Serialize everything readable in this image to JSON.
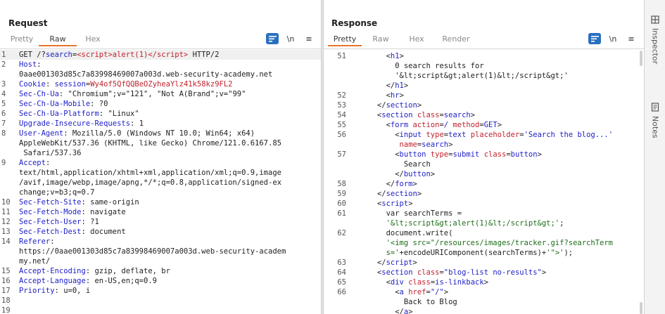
{
  "request": {
    "title": "Request",
    "tabs": [
      {
        "label": "Pretty"
      },
      {
        "label": "Raw"
      },
      {
        "label": "Hex"
      }
    ],
    "toolbar": {
      "newline_label": "\\n",
      "menu_label": "≡"
    },
    "lines": [
      {
        "n": "1",
        "code": "GET /?<span class=\"k\">search</span>=<span class=\"rd\">&lt;script&gt;alert(1)&lt;/script&gt;</span> HTTP/2"
      },
      {
        "n": "2",
        "code": "<span class=\"k\">Host</span>:"
      },
      {
        "n": "",
        "code": "0aae001303d85c7a83998469007a003d.web-security-academy.net"
      },
      {
        "n": "3",
        "code": "<span class=\"k\">Cookie</span>: <span class=\"k\">session</span>=<span class=\"rd\">Wy4of5QfQQBeOZyheaYlz41k58kz9FL2</span>"
      },
      {
        "n": "4",
        "code": "<span class=\"k\">Sec-Ch-Ua</span>: \"Chromium\";v=\"121\", \"Not A(Brand\";v=\"99\""
      },
      {
        "n": "5",
        "code": "<span class=\"k\">Sec-Ch-Ua-Mobile</span>: ?0"
      },
      {
        "n": "6",
        "code": "<span class=\"k\">Sec-Ch-Ua-Platform</span>: \"Linux\""
      },
      {
        "n": "7",
        "code": "<span class=\"k\">Upgrade-Insecure-Requests</span>: 1"
      },
      {
        "n": "8",
        "code": "<span class=\"k\">User-Agent</span>: Mozilla/5.0 (Windows NT 10.0; Win64; x64)"
      },
      {
        "n": "",
        "code": "AppleWebKit/537.36 (KHTML, like Gecko) Chrome/121.0.6167.85"
      },
      {
        "n": "",
        "code": " Safari/537.36"
      },
      {
        "n": "9",
        "code": "<span class=\"k\">Accept</span>:"
      },
      {
        "n": "",
        "code": "text/html,application/xhtml+xml,application/xml;q=0.9,image"
      },
      {
        "n": "",
        "code": "/avif,image/webp,image/apng,*/*;q=0.8,application/signed-ex"
      },
      {
        "n": "",
        "code": "change;v=b3;q=0.7"
      },
      {
        "n": "10",
        "code": "<span class=\"k\">Sec-Fetch-Site</span>: same-origin"
      },
      {
        "n": "11",
        "code": "<span class=\"k\">Sec-Fetch-Mode</span>: navigate"
      },
      {
        "n": "12",
        "code": "<span class=\"k\">Sec-Fetch-User</span>: ?1"
      },
      {
        "n": "13",
        "code": "<span class=\"k\">Sec-Fetch-Dest</span>: document"
      },
      {
        "n": "14",
        "code": "<span class=\"k\">Referer</span>:"
      },
      {
        "n": "",
        "code": "https://0aae001303d85c7a83998469007a003d.web-security-academ"
      },
      {
        "n": "",
        "code": "my.net/"
      },
      {
        "n": "15",
        "code": "<span class=\"k\">Accept-Encoding</span>: gzip, deflate, br"
      },
      {
        "n": "16",
        "code": "<span class=\"k\">Accept-Language</span>: en-US,en;q=0.9"
      },
      {
        "n": "17",
        "code": "<span class=\"k\">Priority</span>: u=0, i"
      },
      {
        "n": "18",
        "code": ""
      },
      {
        "n": "19",
        "code": ""
      }
    ]
  },
  "response": {
    "title": "Response",
    "tabs": [
      {
        "label": "Pretty"
      },
      {
        "label": "Raw"
      },
      {
        "label": "Hex"
      },
      {
        "label": "Render"
      }
    ],
    "toolbar": {
      "newline_label": "\\n",
      "menu_label": "≡"
    },
    "lines": [
      {
        "n": "51",
        "code": "        &lt;<span class=\"k\">h1</span>&gt;"
      },
      {
        "n": "",
        "code": "          0 search results for"
      },
      {
        "n": "",
        "code": "          '&amp;lt;script&amp;gt;alert(1)&amp;lt;/script&amp;gt;'"
      },
      {
        "n": "",
        "code": "        &lt;/<span class=\"k\">h1</span>&gt;"
      },
      {
        "n": "52",
        "code": "        &lt;<span class=\"k\">hr</span>&gt;"
      },
      {
        "n": "53",
        "code": "      &lt;/<span class=\"k\">section</span>&gt;"
      },
      {
        "n": "54",
        "code": "      &lt;<span class=\"k\">section</span> <span class=\"rd\">class</span>=<span class=\"k\">search</span>&gt;"
      },
      {
        "n": "55",
        "code": "        &lt;<span class=\"k\">form</span> <span class=\"rd\">action</span>=<span class=\"k\">/</span> <span class=\"rd\">method</span>=<span class=\"k\">GET</span>&gt;"
      },
      {
        "n": "56",
        "code": "          &lt;<span class=\"k\">input</span> <span class=\"rd\">type</span>=<span class=\"k\">text</span> <span class=\"rd\">placeholder</span>=<span class=\"k\">'Search the blog...'</span>"
      },
      {
        "n": "",
        "code": "           <span class=\"rd\">name</span>=<span class=\"k\">search</span>&gt;"
      },
      {
        "n": "57",
        "code": "          &lt;<span class=\"k\">button</span> <span class=\"rd\">type</span>=<span class=\"k\">submit</span> <span class=\"rd\">class</span>=<span class=\"k\">button</span>&gt;"
      },
      {
        "n": "",
        "code": "            Search"
      },
      {
        "n": "",
        "code": "          &lt;/<span class=\"k\">button</span>&gt;"
      },
      {
        "n": "58",
        "code": "        &lt;/<span class=\"k\">form</span>&gt;"
      },
      {
        "n": "59",
        "code": "      &lt;/<span class=\"k\">section</span>&gt;"
      },
      {
        "n": "60",
        "code": "      &lt;<span class=\"k\">script</span>&gt;"
      },
      {
        "n": "61",
        "code": "        var searchTerms ="
      },
      {
        "n": "",
        "code": "        <span class=\"gr\">'&amp;lt;script&amp;gt;alert(1)&amp;lt;/script&amp;gt;'</span>;"
      },
      {
        "n": "62",
        "code": "        document.write("
      },
      {
        "n": "",
        "code": "        <span class=\"gr\">'&lt;img src=\"/resources/images/tracker.gif?searchTerm</span>"
      },
      {
        "n": "",
        "code": "        <span class=\"gr\">s='</span>+encodeURIComponent(searchTerms)+<span class=\"gr\">'\"&gt;'</span>);"
      },
      {
        "n": "63",
        "code": "      &lt;/<span class=\"k\">script</span>&gt;"
      },
      {
        "n": "64",
        "code": "      &lt;<span class=\"k\">section</span> <span class=\"rd\">class</span>=<span class=\"k\">\"blog-list no-results\"</span>&gt;"
      },
      {
        "n": "65",
        "code": "        &lt;<span class=\"k\">div</span> <span class=\"rd\">class</span>=<span class=\"k\">is-linkback</span>&gt;"
      },
      {
        "n": "66",
        "code": "          &lt;<span class=\"k\">a</span> <span class=\"rd\">href</span>=<span class=\"k\">\"/\"</span>&gt;"
      },
      {
        "n": "",
        "code": "            Back to Blog"
      },
      {
        "n": "",
        "code": "          &lt;/<span class=\"k\">a</span>&gt;"
      }
    ]
  },
  "sidebar": {
    "items": [
      {
        "label": "Inspector"
      },
      {
        "label": "Notes"
      }
    ]
  },
  "colors": {
    "accent": "#e8742d",
    "blue": "#2a6fbf",
    "keyword": "#1d1ec7",
    "value": "#c0222e",
    "string": "#1e6e1a"
  }
}
